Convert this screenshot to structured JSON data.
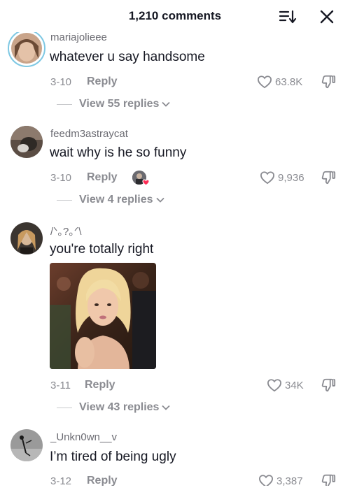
{
  "header": {
    "title": "1,210 comments",
    "sort_icon": "sort-icon",
    "close_icon": "close-icon"
  },
  "comments": [
    {
      "username": "mariajolieee",
      "text": "whatever u say handsome",
      "date": "3-10",
      "reply_label": "Reply",
      "likes": "63.8K",
      "view_replies": "View 55 replies",
      "avatar_ring": "#7ec8e3"
    },
    {
      "username": "feedm3astraycat",
      "text": "wait why is he so funny",
      "date": "3-10",
      "reply_label": "Reply",
      "likes": "9,936",
      "view_replies": "View 4 replies"
    },
    {
      "username": "/ᐠ｡?｡ᐟ\\",
      "text": "you're totally right",
      "date": "3-11",
      "reply_label": "Reply",
      "likes": "34K",
      "view_replies": "View 43 replies",
      "has_gif": true
    },
    {
      "username": "_Unkn0wn__v",
      "text": "I’m tired of being ugly",
      "date": "3-12",
      "reply_label": "Reply",
      "likes": "3,387"
    }
  ],
  "colors": {
    "primary_text": "#161823",
    "secondary_text": "#8a8b91",
    "liked_by_creator": "#fe2c55"
  }
}
